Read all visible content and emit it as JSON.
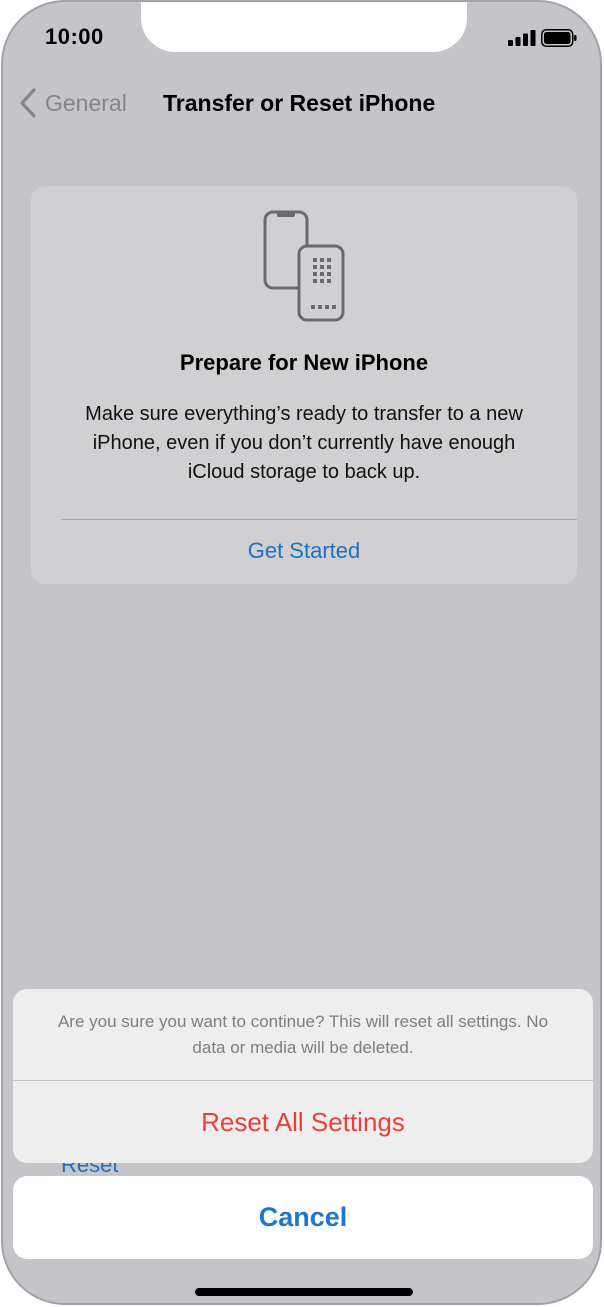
{
  "status_bar": {
    "time": "10:00",
    "signal_icon": "signal-bars-icon",
    "battery_icon": "battery-icon"
  },
  "nav": {
    "back_label": "General",
    "back_icon": "chevron-left-icon",
    "title": "Transfer or Reset iPhone"
  },
  "prepare_card": {
    "icon": "two-phones-icon",
    "title": "Prepare for New iPhone",
    "body": "Make sure everything’s ready to transfer to a new iPhone, even if you don’t currently have enough iCloud storage to back up.",
    "action_label": "Get Started"
  },
  "background_list": {
    "reset_label": "Reset"
  },
  "action_sheet": {
    "message": "Are you sure you want to continue? This will reset all settings. No data or media will be deleted.",
    "destructive_label": "Reset All Settings",
    "cancel_label": "Cancel"
  },
  "colors": {
    "accent": "#1f75d4",
    "destructive": "#e8413c",
    "dimmed_background": "#c5c5c9"
  }
}
